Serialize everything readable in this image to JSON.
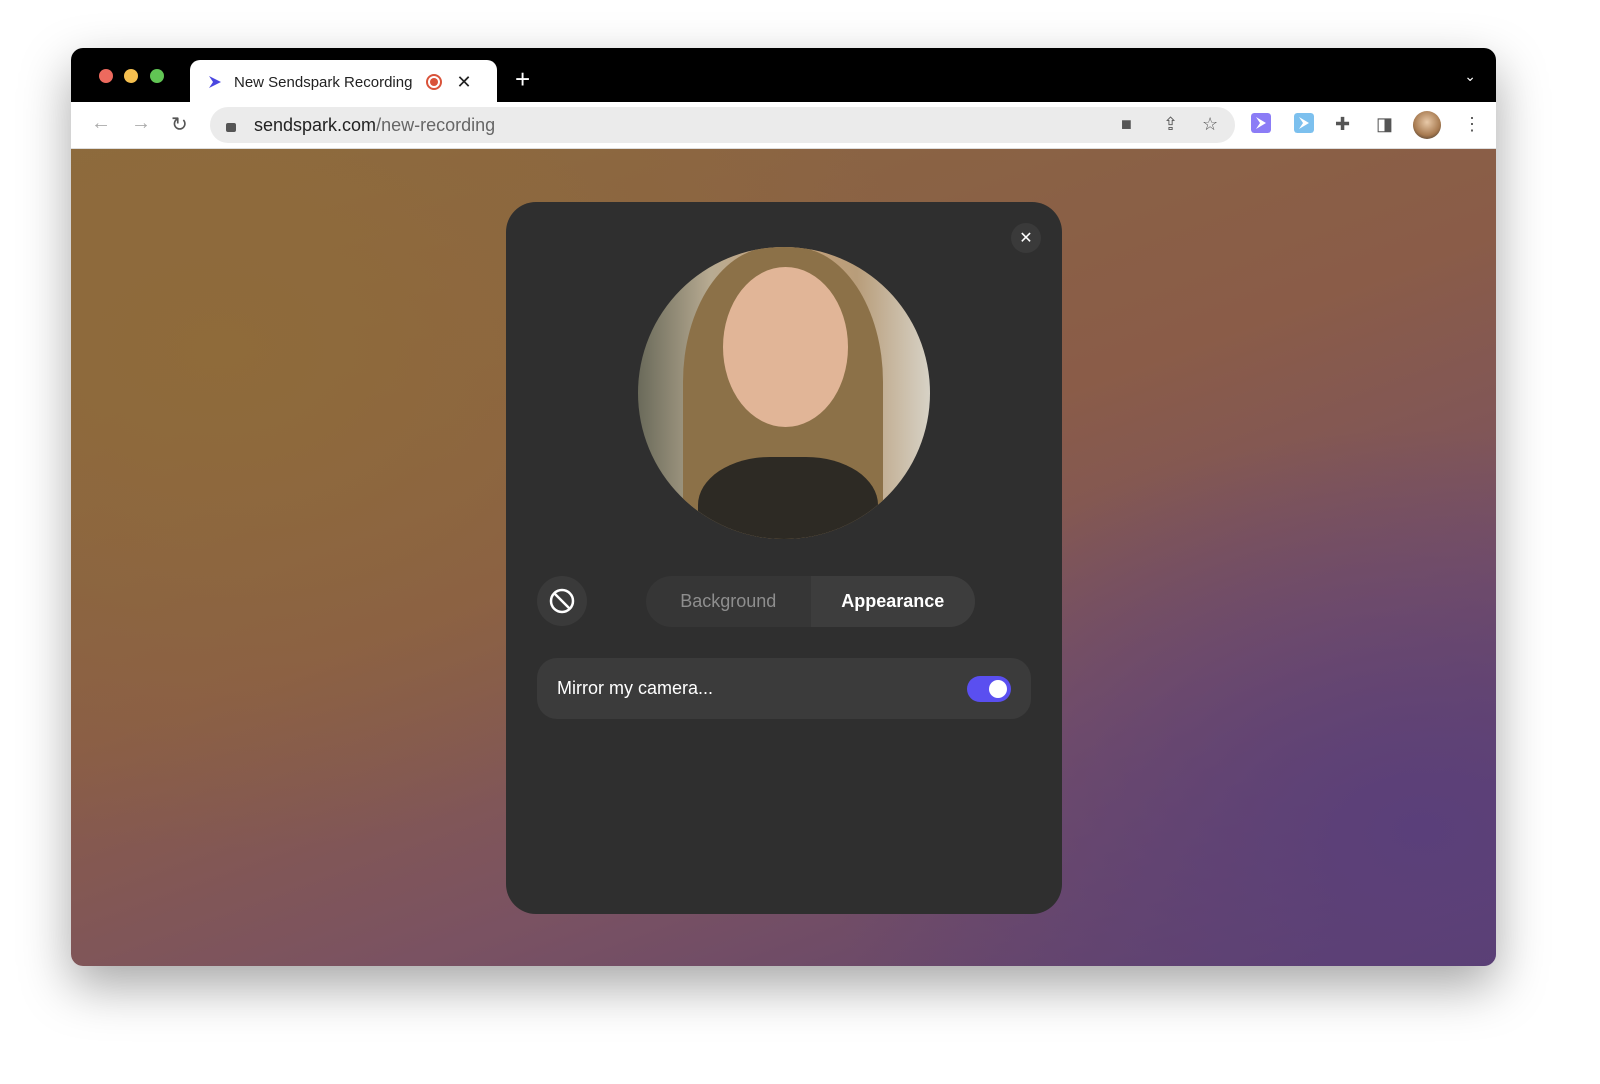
{
  "browser": {
    "tab_title": "New Sendspark Recording",
    "url_domain": "sendspark.com",
    "url_path": "/new-recording",
    "new_tab": "+",
    "close_tab": "✕"
  },
  "modal": {
    "close": "✕",
    "tabs": [
      {
        "label": "Background",
        "active": false
      },
      {
        "label": "Appearance",
        "active": true
      }
    ],
    "mirror_label": "Mirror my camera...",
    "mirror_on": true
  },
  "colors": {
    "accent": "#5a4ff0",
    "modal_bg": "#2f2f2f"
  }
}
